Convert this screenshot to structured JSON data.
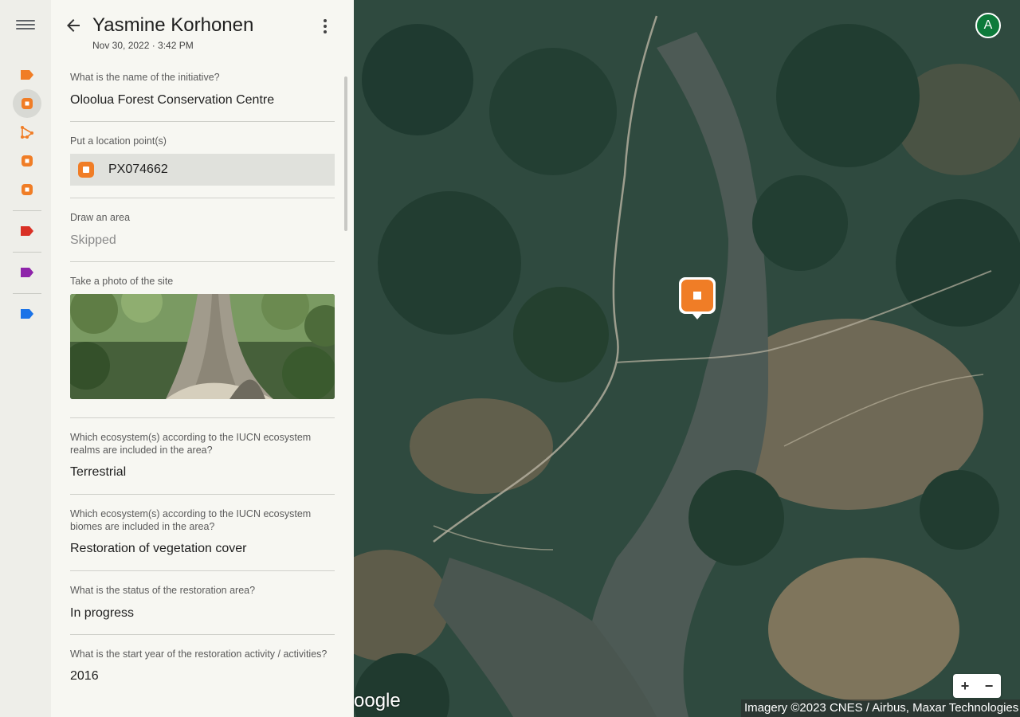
{
  "panel": {
    "title": "Yasmine Korhonen",
    "subtitle": "Nov 30, 2022 · 3:42 PM"
  },
  "questions": [
    {
      "label": "What is the name of the initiative?",
      "value": "Oloolua Forest Conservation Centre"
    },
    {
      "label": "Put a location point(s)",
      "value": "PX074662"
    },
    {
      "label": "Draw an area",
      "value": "Skipped"
    },
    {
      "label": "Take a photo of the site"
    },
    {
      "label": "Which ecosystem(s) according to the IUCN ecosystem realms are included in the area?",
      "value": "Terrestrial"
    },
    {
      "label": "Which ecosystem(s) according to the IUCN ecosystem biomes are included in the area?",
      "value": "Restoration of vegetation cover"
    },
    {
      "label": "What is the status of the restoration area?",
      "value": "In progress"
    },
    {
      "label": "What is the start year of the restoration activity / activities?",
      "value": "2016"
    }
  ],
  "map": {
    "avatar_initial": "A",
    "zoom_in": "+",
    "zoom_out": "−",
    "logo_text": "oogle",
    "attribution": "Imagery ©2023 CNES / Airbus, Maxar Technologies"
  },
  "colors": {
    "point_orange": "#f07d26",
    "red_tag": "#d93025",
    "purple_tag": "#8e24aa",
    "blue_tag": "#1a73e8",
    "avatar_green": "#0d7a3a"
  },
  "rail_icons": [
    "menu-icon",
    "orange-tag-icon",
    "point-icon",
    "polygon-icon",
    "point-icon",
    "point-icon",
    "red-tag-icon",
    "purple-tag-icon",
    "blue-tag-icon"
  ]
}
